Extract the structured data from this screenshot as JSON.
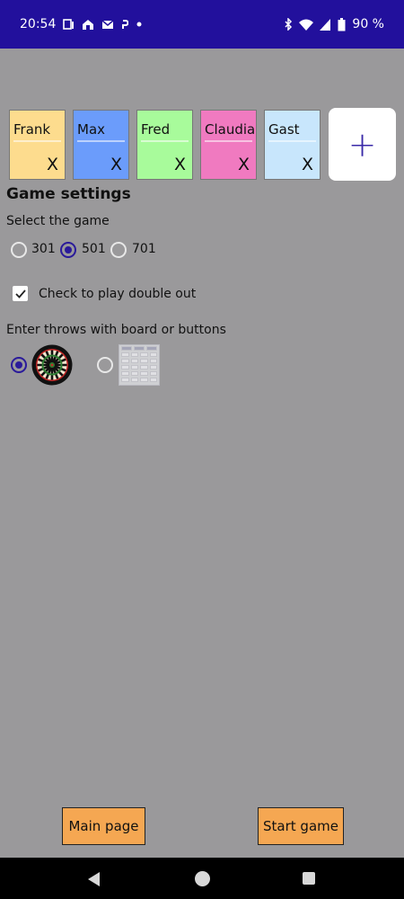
{
  "status_bar": {
    "time": "20:54",
    "battery": "90 %",
    "left_icons": [
      "notification-icon",
      "home-icon",
      "mail-icon",
      "p-icon",
      "dot-icon"
    ],
    "right_icons": [
      "bluetooth-icon",
      "wifi-icon",
      "signal-icon",
      "battery-icon"
    ]
  },
  "players": [
    {
      "name": "Frank",
      "remove": "X",
      "color": "#fddc8e"
    },
    {
      "name": "Max",
      "remove": "X",
      "color": "#6b9cfb"
    },
    {
      "name": "Fred",
      "remove": "X",
      "color": "#a8fb9b"
    },
    {
      "name": "Claudia",
      "remove": "X",
      "color": "#f07ac0"
    },
    {
      "name": "Gast",
      "remove": "X",
      "color": "#c8e6fc"
    }
  ],
  "add_player": {
    "label": "+"
  },
  "settings": {
    "title": "Game settings",
    "select_game_label": "Select the game",
    "game_options": [
      {
        "label": "301",
        "checked": false
      },
      {
        "label": "501",
        "checked": true
      },
      {
        "label": "701",
        "checked": false
      }
    ],
    "double_out": {
      "label": "Check to play double out",
      "checked": true
    },
    "input_mode_label": "Enter throws with board or buttons",
    "input_modes": [
      {
        "name": "board",
        "checked": true
      },
      {
        "name": "buttons",
        "checked": false
      }
    ]
  },
  "buttons": {
    "main_page": "Main page",
    "start_game": "Start game"
  },
  "colors": {
    "status_bar": "#22109c",
    "background": "#9a999b",
    "accent": "#2a1a9a",
    "button": "#f5a752"
  }
}
